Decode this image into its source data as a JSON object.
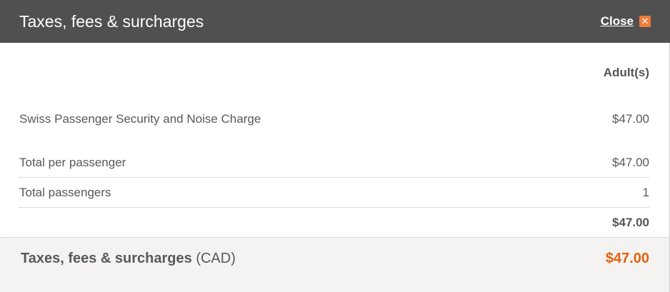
{
  "dialog": {
    "title": "Taxes, fees & surcharges",
    "close_label": "Close",
    "close_icon": "close-icon"
  },
  "table": {
    "column_header": "Adult(s)",
    "charges": [
      {
        "label": "Swiss Passenger Security and Noise Charge",
        "value": "$47.00"
      }
    ],
    "total_per_passenger": {
      "label": "Total per passenger",
      "value": "$47.00"
    },
    "total_passengers": {
      "label": "Total passengers",
      "value": "1"
    },
    "subtotal": "$47.00"
  },
  "footer": {
    "label_bold": "Taxes, fees & surcharges",
    "label_currency": "(CAD)",
    "amount": "$47.00",
    "amount_color": "#e8600e"
  }
}
